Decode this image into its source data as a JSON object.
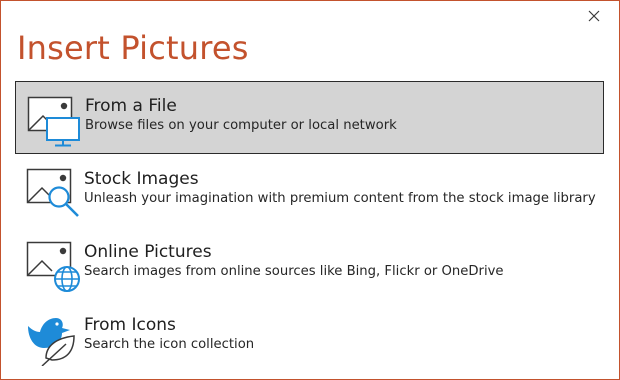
{
  "dialog": {
    "title": "Insert Pictures",
    "close_icon": "close-icon"
  },
  "options": [
    {
      "name": "From a File",
      "description": "Browse files on your computer or local network",
      "icon": "picture-computer-icon",
      "selected": true
    },
    {
      "name": "Stock Images",
      "description": "Unleash your imagination with premium content from the stock image library",
      "icon": "picture-search-icon",
      "selected": false
    },
    {
      "name": "Online Pictures",
      "description": "Search images from online sources like Bing, Flickr or OneDrive",
      "icon": "picture-globe-icon",
      "selected": false
    },
    {
      "name": "From Icons",
      "description": "Search the icon collection",
      "icon": "bird-leaf-icon",
      "selected": false
    }
  ],
  "colors": {
    "accent": "#c3522d",
    "icon_blue": "#1e8bd8",
    "selected_background": "#d4d4d4",
    "selected_border": "#2b2b2b"
  }
}
